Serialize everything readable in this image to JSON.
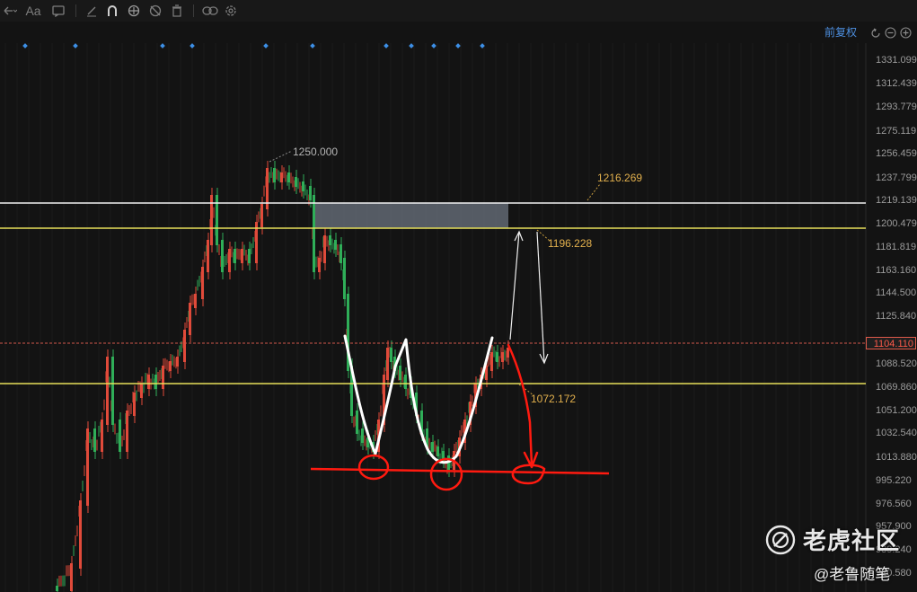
{
  "toolbar": {
    "text_tool_label": "Aa",
    "icons": [
      "back-arrow-icon",
      "text-tool-icon",
      "comment-icon",
      "pen-icon",
      "magnet-icon",
      "eye-icon",
      "hide-icon",
      "trash-icon",
      "link-icon",
      "gear-icon"
    ]
  },
  "header": {
    "price_mode_label": "前复权",
    "view_controls": [
      "reset-icon",
      "zoom-out-icon",
      "zoom-in-icon"
    ]
  },
  "price_axis": {
    "labels": [
      "1331.099",
      "1312.439",
      "1293.779",
      "1275.119",
      "1256.459",
      "1237.799",
      "1219.139",
      "1200.479",
      "1181.819",
      "1163.160",
      "1144.500",
      "1125.840",
      "1088.520",
      "1069.860",
      "1051.200",
      "1032.540",
      "1013.880",
      "995.220",
      "976.560",
      "957.900",
      "939.240",
      "920.580"
    ],
    "current_price": "1104.110"
  },
  "annotations": {
    "peak": "1250.000",
    "upper_line": "1216.269",
    "mid_line": "1196.228",
    "low_line": "1072.172"
  },
  "colors": {
    "background": "#131313",
    "up_candle": "#e04a3a",
    "down_candle": "#2fae58",
    "level_white": "#f2f2f2",
    "level_yellow": "#e7e05a",
    "zone_fill": "#6c7480",
    "current_price_line": "#d0574b",
    "hand_drawn_white": "#ffffff",
    "hand_drawn_red": "#ff1a10",
    "marker_blue": "#3d8fe6",
    "price_mode_blue": "#4d8fe0"
  },
  "watermark": {
    "title": "老虎社区",
    "handle": "@老鲁随笔"
  }
}
